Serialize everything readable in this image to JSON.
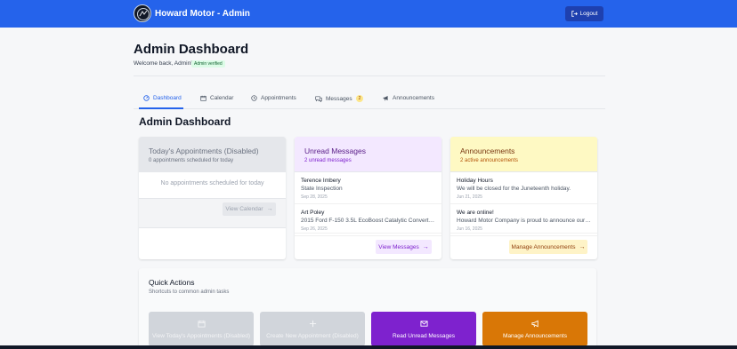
{
  "header": {
    "brand": "Howard Motor - Admin",
    "logout_label": "Logout",
    "logout_icon": "sign-out-icon"
  },
  "page": {
    "title": "Admin Dashboard",
    "welcome": "Welcome back, Admin!",
    "verified_badge": "Admin verified"
  },
  "tabs": [
    {
      "label": "Dashboard",
      "icon": "dashboard-icon",
      "active": true
    },
    {
      "label": "Calendar",
      "icon": "calendar-icon",
      "active": false
    },
    {
      "label": "Appointments",
      "icon": "clock-icon",
      "active": false
    },
    {
      "label": "Messages",
      "icon": "chat-icon",
      "active": false,
      "badge": "2"
    },
    {
      "label": "Announcements",
      "icon": "megaphone-icon",
      "active": false
    }
  ],
  "section_title": "Admin Dashboard",
  "appointments_card": {
    "title": "Today's Appointments (Disabled)",
    "subtitle": "0 appointments scheduled for today",
    "empty_text": "No appointments scheduled for today",
    "button_label": "View Calendar",
    "button_arrow": "→"
  },
  "messages_card": {
    "title": "Unread Messages",
    "subtitle": "2 unread messages",
    "items": [
      {
        "name": "Terence Imbery",
        "text": "State Inspection",
        "date": "Sep 28, 2025"
      },
      {
        "name": "Art Poley",
        "text": "2015 Ford F-150 3.5L EcoBoost Catalytic Converters",
        "date": "Sep 26, 2025"
      }
    ],
    "button_label": "View Messages",
    "button_arrow": "→"
  },
  "announcements_card": {
    "title": "Announcements",
    "subtitle": "2 active announcements",
    "items": [
      {
        "name": "Holiday Hours",
        "text": "We will be closed for the Juneteenth holiday.",
        "date": "Jun 21, 2025"
      },
      {
        "name": "We are online!",
        "text": "Howard Motor Company is proud to announce our ne...",
        "date": "Jun 16, 2025"
      }
    ],
    "button_label": "Manage Announcements",
    "button_arrow": "→"
  },
  "quick_actions": {
    "title": "Quick Actions",
    "subtitle": "Shortcuts to common admin tasks",
    "buttons": [
      {
        "label": "View Today's Appointments (Disabled)",
        "icon": "calendar-day-icon"
      },
      {
        "label": "Create New Appointment (Disabled)",
        "icon": "plus-icon"
      },
      {
        "label": "Read Unread Messages",
        "icon": "envelope-icon"
      },
      {
        "label": "Manage Announcements",
        "icon": "megaphone-icon"
      }
    ]
  },
  "colors": {
    "primary": "#2563eb",
    "purple": "#7e22ce",
    "orange": "#d97706",
    "disabled": "#d1d5db"
  }
}
